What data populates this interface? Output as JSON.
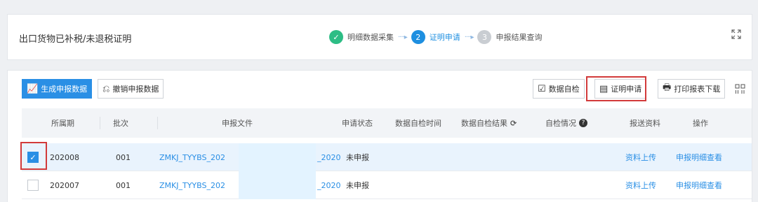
{
  "header": {
    "title": "出口货物已补税/未退税证明",
    "steps": [
      {
        "num": "✓",
        "label": "明细数据采集",
        "state": "done"
      },
      {
        "num": "2",
        "label": "证明申请",
        "state": "active"
      },
      {
        "num": "3",
        "label": "申报结果查询",
        "state": "todo"
      }
    ],
    "arrow": "····▸",
    "expand_icon": "expand-icon"
  },
  "toolbar": {
    "generate_label": "生成申报数据",
    "cancel_label": "撤销申报数据",
    "self_check_label": "数据自检",
    "cert_apply_label": "证明申请",
    "print_label": "打印报表下载"
  },
  "table": {
    "columns": [
      "所属期",
      "批次",
      "申报文件",
      "申请状态",
      "数据自检时间",
      "数据自检结果",
      "自检情况",
      "报送资料",
      "操作"
    ],
    "rows": [
      {
        "checked": true,
        "period": "202008",
        "batch": "001",
        "file_prefix": "ZMKJ_TYYBS_202",
        "file_suffix": "_2020",
        "status": "未申报",
        "upload": "资料上传",
        "detail": "申报明细查看"
      },
      {
        "checked": false,
        "period": "202007",
        "batch": "001",
        "file_prefix": "ZMKJ_TYYBS_202",
        "file_suffix": "_2020",
        "status": "未申报",
        "upload": "资料上传",
        "detail": "申报明细查看"
      }
    ]
  },
  "colors": {
    "accent": "#2a8fe5",
    "done": "#2dbd85",
    "highlight": "#d23a3a"
  }
}
